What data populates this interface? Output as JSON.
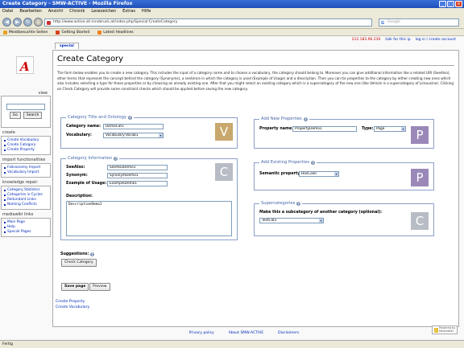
{
  "browser": {
    "title": "Create Category - SMW-ACTIVE - Mozilla Firefox",
    "menu": [
      "Datei",
      "Bearbeiten",
      "Ansicht",
      "Chronik",
      "Lesezeichen",
      "Extras",
      "Hilfe"
    ],
    "url": "http://www.active.sti-innsbruck.at/index.php/Special:CreateCategory",
    "search_placeholder": "Google",
    "bookmarks": [
      "Meistbesuchte Seiten",
      "Getting Started",
      "Latest Headlines"
    ],
    "status": "Fertig"
  },
  "personal": {
    "ip": "212.183.96.230",
    "talk": "talk for this ip",
    "login": "log in / create account"
  },
  "sidebar": {
    "search_title": "view",
    "go": "Go",
    "search": "Search",
    "sections": [
      {
        "title": "create",
        "items": [
          "Create Vocabulary",
          "Create Category",
          "Create Property"
        ]
      },
      {
        "title": "import functionalities",
        "items": [
          "Folksonomy Import",
          "Vocabulary Import"
        ]
      },
      {
        "title": "knowledge repair",
        "items": [
          "Category Statistics",
          "Categories in Cycles",
          "Redundant Links",
          "Naming Conflicts"
        ]
      },
      {
        "title": "mediawiki links",
        "items": [
          "Main Page",
          "Help",
          "Special Pages"
        ]
      }
    ]
  },
  "tab": "special",
  "page": {
    "title": "Create Category",
    "intro": "The form below enables you to create a new category. This includes the input of a category name and to choose a vocabulary, the category should belong to. Moreover you can give additional information like a related URI (SeeAlso), other terms that represent the concept behind the category (Synonyms), a sentence in which the category is used (Example of Usage) and a description. Then you can tie properties to the category by either creating new ones which also includes selecting a type for these properties or by choosing an already existing one. After that you might select an existing category which is a supercategory of the new one (like Vehicle is a supercategory of Limousine). Clicking on Check Category will provide some constraint checks which should be applied before saving the new category."
  },
  "title_box": {
    "legend": "Category Title and Ontology",
    "name_label": "Category name:",
    "name_value": "DemoCat1",
    "vocab_label": "Vocabulary:",
    "vocab_value": "Vocabulary:Vocab1",
    "letter": "V",
    "color": "#c8a86c"
  },
  "info_box": {
    "legend": "Category Information",
    "seealso_label": "SeeAlso:",
    "seealso_value": "SeeAlsoDemo1",
    "synonym_label": "Synonym:",
    "synonym_value": "SynonymDemo1",
    "example_label": "Example of Usage:",
    "example_value": "ExampleDemo1",
    "desc_label": "Description:",
    "desc_value": "DescriptionDemo1",
    "letter": "C",
    "color": "#b8bcc4"
  },
  "suggestions": {
    "label": "Suggestions:",
    "check": "Check Category"
  },
  "actions": {
    "save": "Save page",
    "preview": "Preview"
  },
  "newprop_box": {
    "legend": "Add New Properties",
    "name_label": "Property name:",
    "name_value": "PropertyDemo1",
    "type_label": "Type:",
    "type_value": "Page",
    "letter": "P",
    "color": "#9a88b8"
  },
  "existprop_box": {
    "legend": "Add Existing Properties",
    "sem_label": "Semantic property:",
    "sem_value": "HasColor",
    "letter": "P",
    "color": "#9a88b8"
  },
  "supercat_box": {
    "legend": "Supercategories",
    "sub_label": "Make this a subcategory of another category (optional):",
    "sub_value": "TestCat1",
    "letter": "C",
    "color": "#b8bcc4"
  },
  "catlinks": [
    "Create Property",
    "Create Vocabulary"
  ],
  "footer": [
    "Privacy policy",
    "About SMW-ACTIVE",
    "Disclaimers"
  ],
  "badge": "Powered by MediaWiki"
}
